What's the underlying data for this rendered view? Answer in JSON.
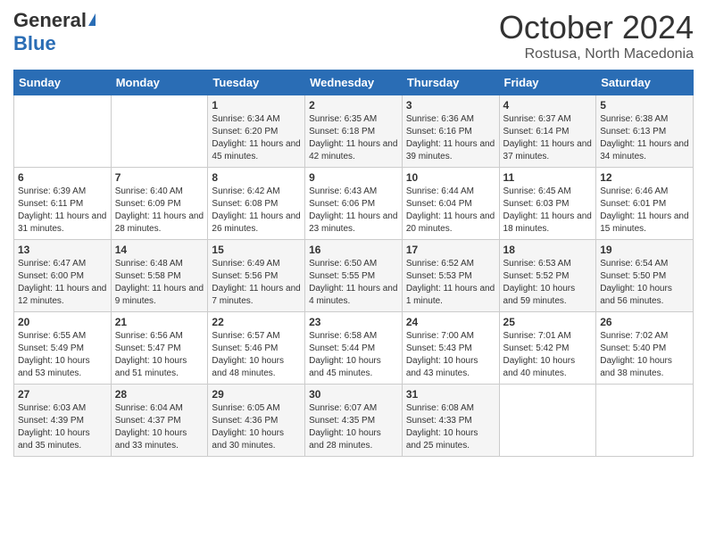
{
  "logo": {
    "general": "General",
    "blue": "Blue"
  },
  "title": "October 2024",
  "subtitle": "Rostusa, North Macedonia",
  "days_of_week": [
    "Sunday",
    "Monday",
    "Tuesday",
    "Wednesday",
    "Thursday",
    "Friday",
    "Saturday"
  ],
  "weeks": [
    [
      {
        "day": "",
        "info": ""
      },
      {
        "day": "",
        "info": ""
      },
      {
        "day": "1",
        "info": "Sunrise: 6:34 AM\nSunset: 6:20 PM\nDaylight: 11 hours and 45 minutes."
      },
      {
        "day": "2",
        "info": "Sunrise: 6:35 AM\nSunset: 6:18 PM\nDaylight: 11 hours and 42 minutes."
      },
      {
        "day": "3",
        "info": "Sunrise: 6:36 AM\nSunset: 6:16 PM\nDaylight: 11 hours and 39 minutes."
      },
      {
        "day": "4",
        "info": "Sunrise: 6:37 AM\nSunset: 6:14 PM\nDaylight: 11 hours and 37 minutes."
      },
      {
        "day": "5",
        "info": "Sunrise: 6:38 AM\nSunset: 6:13 PM\nDaylight: 11 hours and 34 minutes."
      }
    ],
    [
      {
        "day": "6",
        "info": "Sunrise: 6:39 AM\nSunset: 6:11 PM\nDaylight: 11 hours and 31 minutes."
      },
      {
        "day": "7",
        "info": "Sunrise: 6:40 AM\nSunset: 6:09 PM\nDaylight: 11 hours and 28 minutes."
      },
      {
        "day": "8",
        "info": "Sunrise: 6:42 AM\nSunset: 6:08 PM\nDaylight: 11 hours and 26 minutes."
      },
      {
        "day": "9",
        "info": "Sunrise: 6:43 AM\nSunset: 6:06 PM\nDaylight: 11 hours and 23 minutes."
      },
      {
        "day": "10",
        "info": "Sunrise: 6:44 AM\nSunset: 6:04 PM\nDaylight: 11 hours and 20 minutes."
      },
      {
        "day": "11",
        "info": "Sunrise: 6:45 AM\nSunset: 6:03 PM\nDaylight: 11 hours and 18 minutes."
      },
      {
        "day": "12",
        "info": "Sunrise: 6:46 AM\nSunset: 6:01 PM\nDaylight: 11 hours and 15 minutes."
      }
    ],
    [
      {
        "day": "13",
        "info": "Sunrise: 6:47 AM\nSunset: 6:00 PM\nDaylight: 11 hours and 12 minutes."
      },
      {
        "day": "14",
        "info": "Sunrise: 6:48 AM\nSunset: 5:58 PM\nDaylight: 11 hours and 9 minutes."
      },
      {
        "day": "15",
        "info": "Sunrise: 6:49 AM\nSunset: 5:56 PM\nDaylight: 11 hours and 7 minutes."
      },
      {
        "day": "16",
        "info": "Sunrise: 6:50 AM\nSunset: 5:55 PM\nDaylight: 11 hours and 4 minutes."
      },
      {
        "day": "17",
        "info": "Sunrise: 6:52 AM\nSunset: 5:53 PM\nDaylight: 11 hours and 1 minute."
      },
      {
        "day": "18",
        "info": "Sunrise: 6:53 AM\nSunset: 5:52 PM\nDaylight: 10 hours and 59 minutes."
      },
      {
        "day": "19",
        "info": "Sunrise: 6:54 AM\nSunset: 5:50 PM\nDaylight: 10 hours and 56 minutes."
      }
    ],
    [
      {
        "day": "20",
        "info": "Sunrise: 6:55 AM\nSunset: 5:49 PM\nDaylight: 10 hours and 53 minutes."
      },
      {
        "day": "21",
        "info": "Sunrise: 6:56 AM\nSunset: 5:47 PM\nDaylight: 10 hours and 51 minutes."
      },
      {
        "day": "22",
        "info": "Sunrise: 6:57 AM\nSunset: 5:46 PM\nDaylight: 10 hours and 48 minutes."
      },
      {
        "day": "23",
        "info": "Sunrise: 6:58 AM\nSunset: 5:44 PM\nDaylight: 10 hours and 45 minutes."
      },
      {
        "day": "24",
        "info": "Sunrise: 7:00 AM\nSunset: 5:43 PM\nDaylight: 10 hours and 43 minutes."
      },
      {
        "day": "25",
        "info": "Sunrise: 7:01 AM\nSunset: 5:42 PM\nDaylight: 10 hours and 40 minutes."
      },
      {
        "day": "26",
        "info": "Sunrise: 7:02 AM\nSunset: 5:40 PM\nDaylight: 10 hours and 38 minutes."
      }
    ],
    [
      {
        "day": "27",
        "info": "Sunrise: 6:03 AM\nSunset: 4:39 PM\nDaylight: 10 hours and 35 minutes."
      },
      {
        "day": "28",
        "info": "Sunrise: 6:04 AM\nSunset: 4:37 PM\nDaylight: 10 hours and 33 minutes."
      },
      {
        "day": "29",
        "info": "Sunrise: 6:05 AM\nSunset: 4:36 PM\nDaylight: 10 hours and 30 minutes."
      },
      {
        "day": "30",
        "info": "Sunrise: 6:07 AM\nSunset: 4:35 PM\nDaylight: 10 hours and 28 minutes."
      },
      {
        "day": "31",
        "info": "Sunrise: 6:08 AM\nSunset: 4:33 PM\nDaylight: 10 hours and 25 minutes."
      },
      {
        "day": "",
        "info": ""
      },
      {
        "day": "",
        "info": ""
      }
    ]
  ]
}
